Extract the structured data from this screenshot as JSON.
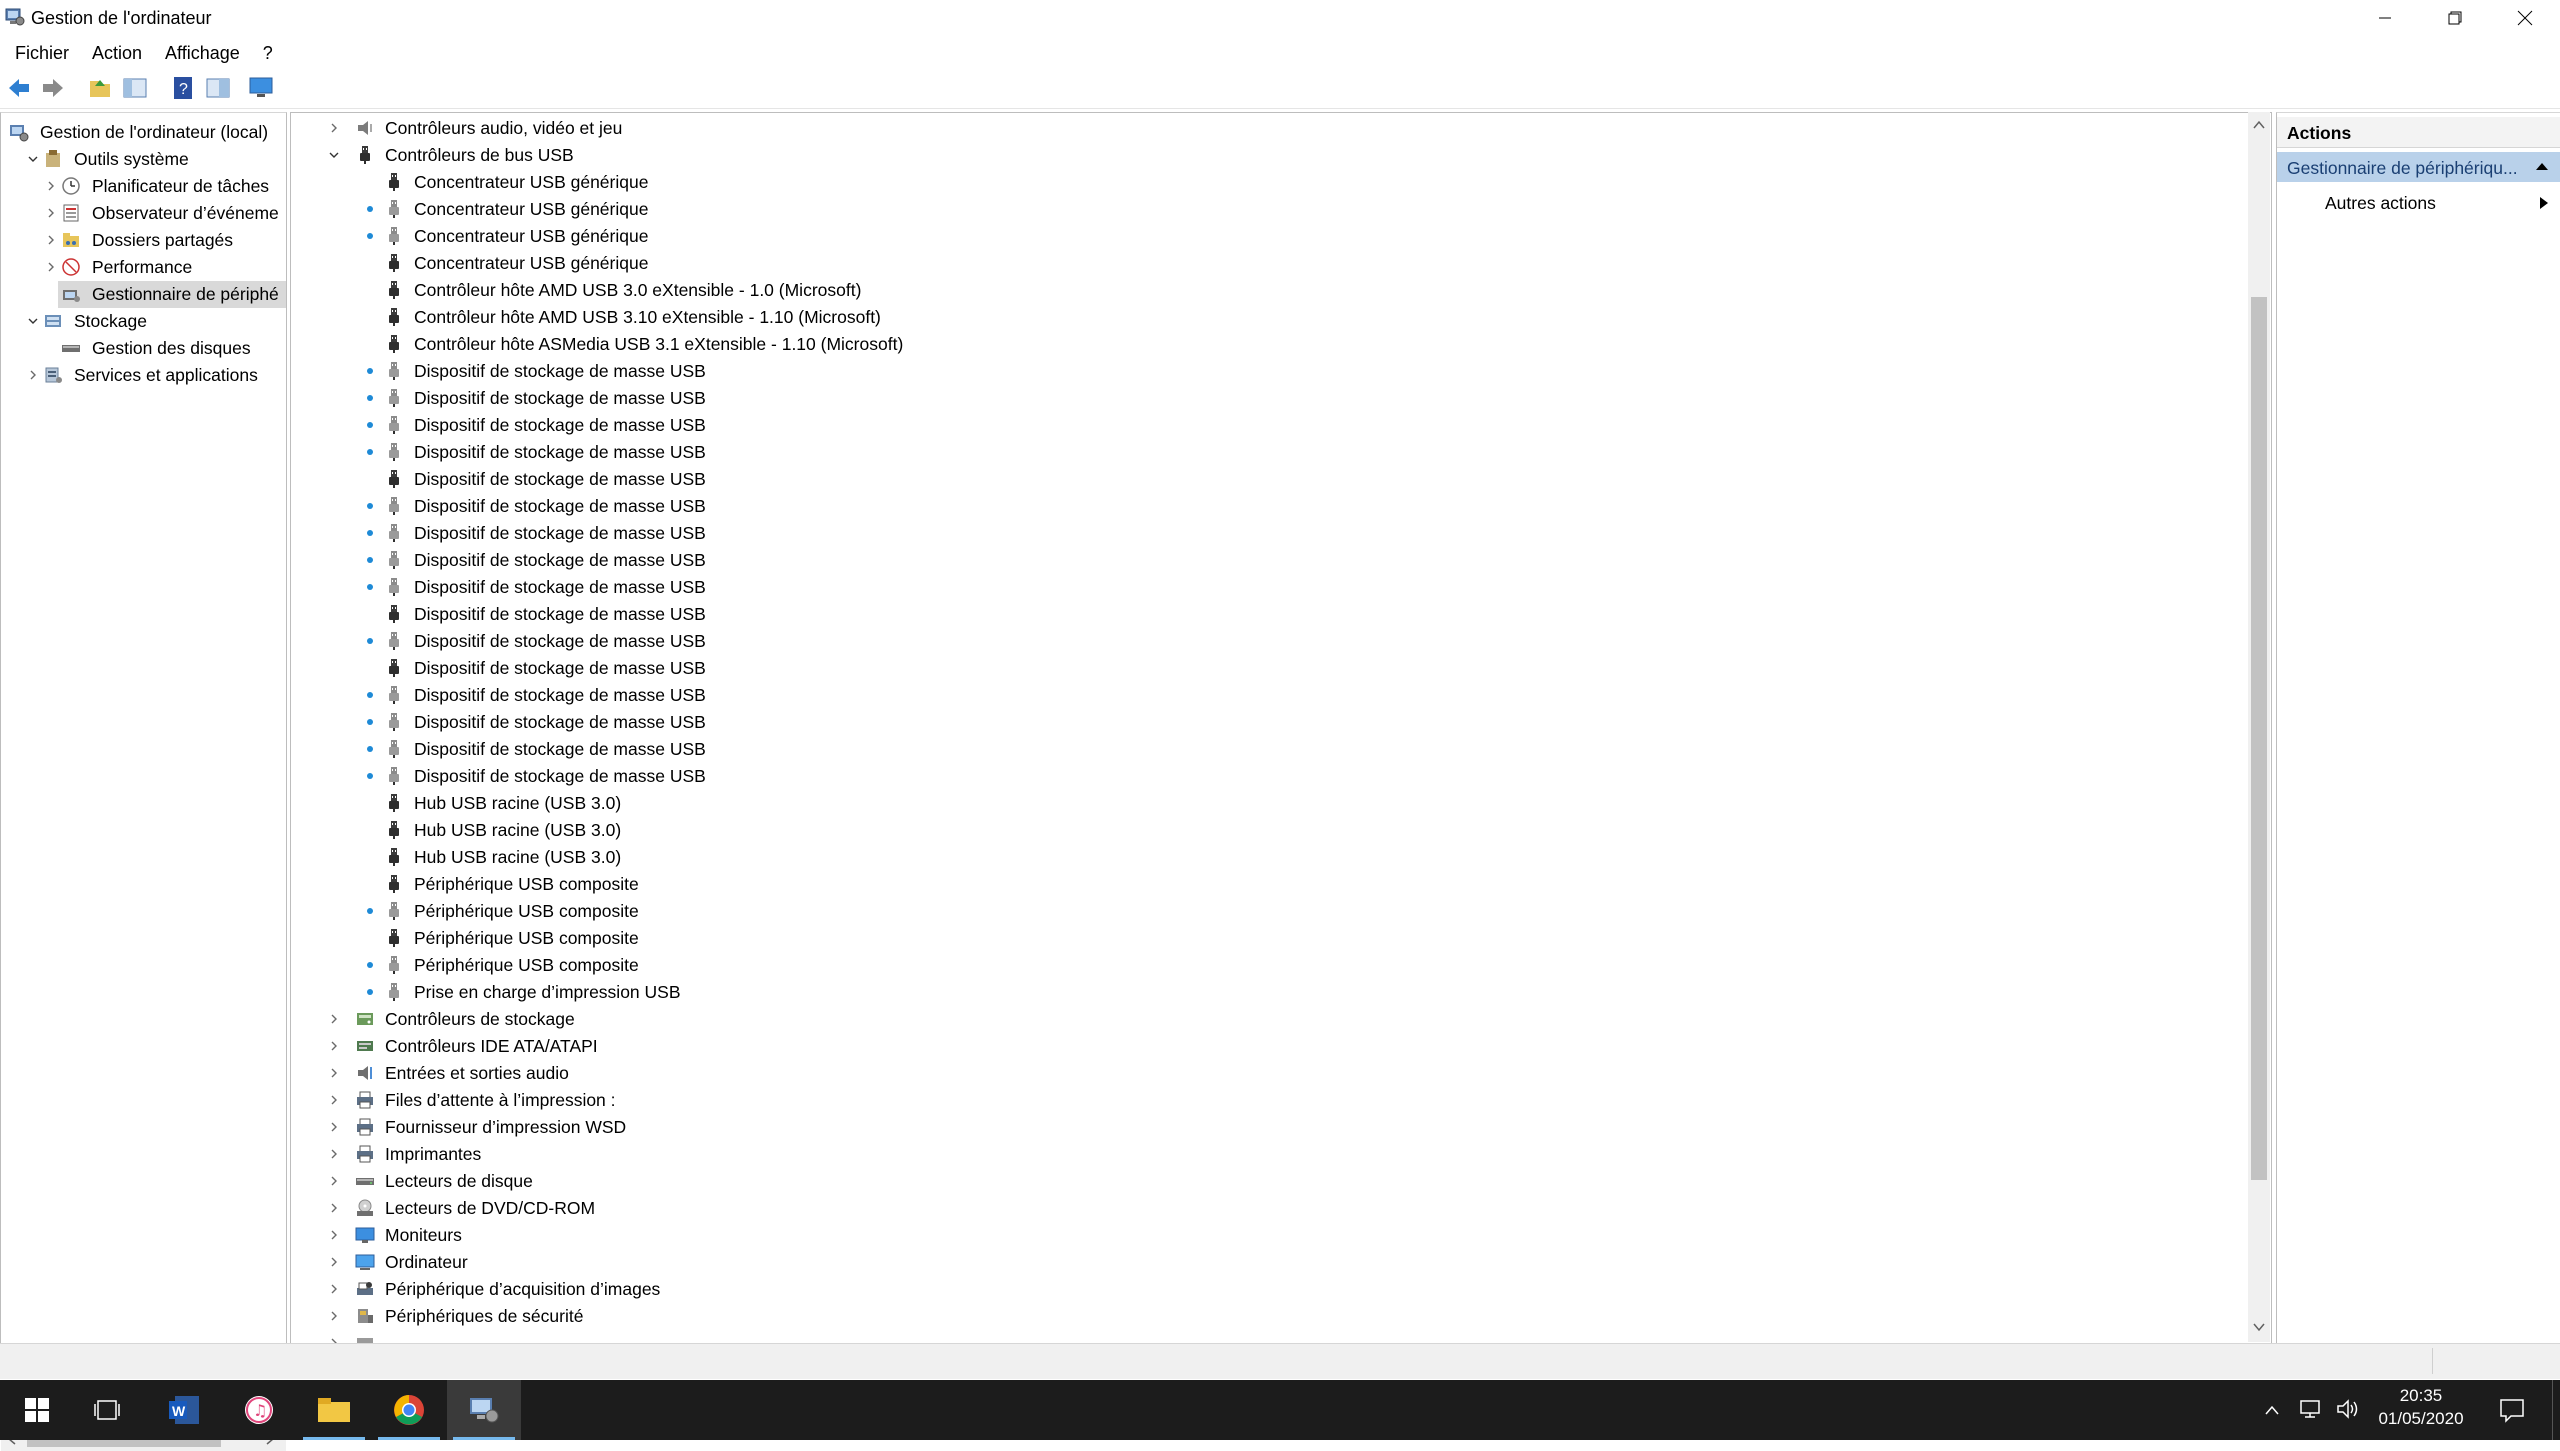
{
  "window": {
    "title": "Gestion de l'ordinateur"
  },
  "menu": [
    "Fichier",
    "Action",
    "Affichage",
    "?"
  ],
  "tree": {
    "root": "Gestion de l'ordinateur (local)",
    "outils": "Outils système",
    "outils_items": [
      "Planificateur de tâches",
      "Observateur d’événeme",
      "Dossiers partagés",
      "Performance",
      "Gestionnaire de périphé"
    ],
    "stockage": "Stockage",
    "stockage_items": [
      "Gestion des disques"
    ],
    "services": "Services et applications"
  },
  "devices": {
    "categories_top": [
      "Contrôleurs audio, vidéo et jeu",
      "Contrôleurs de bus USB"
    ],
    "usb_children": [
      "Concentrateur USB générique",
      "Concentrateur USB générique",
      "Concentrateur USB générique",
      "Concentrateur USB générique",
      "Contrôleur hôte AMD USB 3.0 eXtensible - 1.0 (Microsoft)",
      "Contrôleur hôte AMD USB 3.10 eXtensible - 1.10 (Microsoft)",
      "Contrôleur hôte ASMedia USB 3.1 eXtensible - 1.10 (Microsoft)",
      "Dispositif de stockage de masse USB",
      "Dispositif de stockage de masse USB",
      "Dispositif de stockage de masse USB",
      "Dispositif de stockage de masse USB",
      "Dispositif de stockage de masse USB",
      "Dispositif de stockage de masse USB",
      "Dispositif de stockage de masse USB",
      "Dispositif de stockage de masse USB",
      "Dispositif de stockage de masse USB",
      "Dispositif de stockage de masse USB",
      "Dispositif de stockage de masse USB",
      "Dispositif de stockage de masse USB",
      "Dispositif de stockage de masse USB",
      "Dispositif de stockage de masse USB",
      "Dispositif de stockage de masse USB",
      "Dispositif de stockage de masse USB",
      "Hub USB racine (USB 3.0)",
      "Hub USB racine (USB 3.0)",
      "Hub USB racine (USB 3.0)",
      "Périphérique USB composite",
      "Périphérique USB composite",
      "Périphérique USB composite",
      "Périphérique USB composite",
      "Prise en charge d’impression USB"
    ],
    "categories_bottom": [
      "Contrôleurs de stockage",
      "Contrôleurs IDE ATA/ATAPI",
      "Entrées et sorties audio",
      "Files d’attente à l’impression :",
      "Fournisseur d’impression WSD",
      "Imprimantes",
      "Lecteurs de disque",
      "Lecteurs de DVD/CD-ROM",
      "Moniteurs",
      "Ordinateur",
      "Périphérique d’acquisition d’images",
      "Périphériques de sécurité"
    ]
  },
  "actions": {
    "header": "Actions",
    "section": "Gestionnaire de périphériqu...",
    "more": "Autres actions"
  },
  "taskbar": {
    "time": "20:35",
    "date": "01/05/2020"
  },
  "colors": {
    "accent": "#0078d7",
    "selection": "#d9d9d9",
    "actions_selected": "#b9d1ea",
    "taskbar": "#1c1c1c"
  }
}
